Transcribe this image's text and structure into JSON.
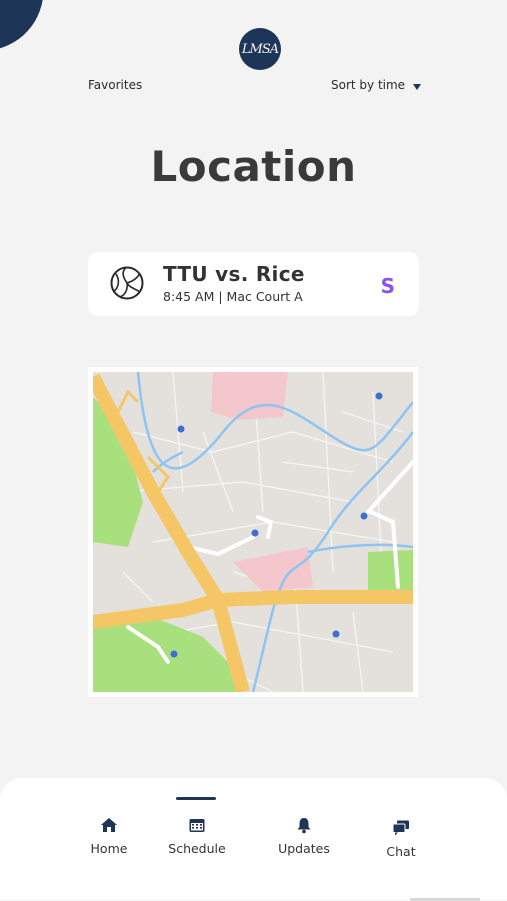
{
  "header": {
    "logo_text": "LMSA",
    "favorites_label": "Favorites",
    "sort_label": "Sort by time"
  },
  "page": {
    "title": "Location"
  },
  "event": {
    "title": "TTU vs. Rice",
    "details": "8:45 AM | Mac Court A",
    "badge": "S",
    "icon": "volleyball-icon"
  },
  "map": {
    "marker_count": 6
  },
  "tabs": [
    {
      "label": "Home",
      "icon": "home-icon"
    },
    {
      "label": "Schedule",
      "icon": "calendar-icon",
      "active": true
    },
    {
      "label": "Updates",
      "icon": "bell-icon"
    },
    {
      "label": "Chat",
      "icon": "chat-icon"
    }
  ],
  "colors": {
    "navy": "#1d3557",
    "background": "#f3f3f3",
    "badge": "#8a55e6",
    "road": "#f5c665",
    "park": "#a8e07e",
    "water": "#8ec4f2"
  }
}
